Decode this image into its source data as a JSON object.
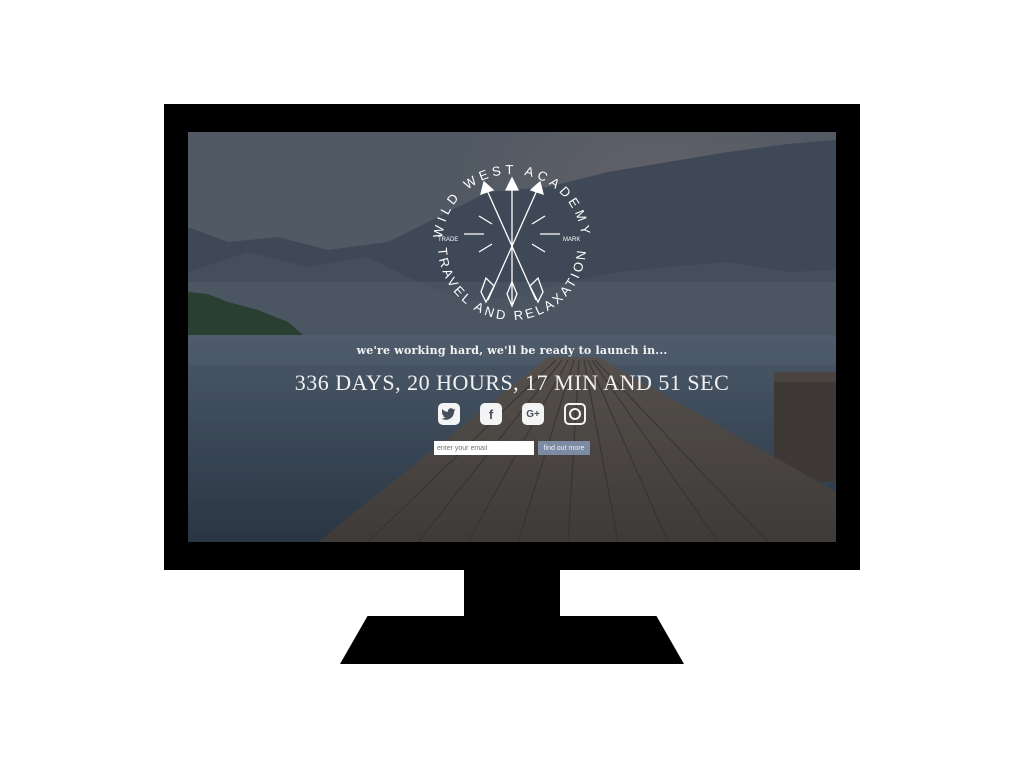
{
  "logo": {
    "top_text": "WILD WEST ACADEMY",
    "bottom_text": "TRAVEL AND RELAXATION",
    "left_mark": "TRADE",
    "right_mark": "MARK"
  },
  "tagline": "we're working hard, we'll be ready to launch in...",
  "countdown": "336 DAYS, 20 HOURS, 17 MIN AND 51 SEC",
  "socials": {
    "twitter": "twitter-icon",
    "facebook": "facebook-icon",
    "facebook_glyph": "f",
    "googleplus": "google-plus-icon",
    "googleplus_glyph": "G+",
    "instagram": "instagram-icon"
  },
  "form": {
    "email_placeholder": "enter your email",
    "button_label": "find out more",
    "button_color": "#7c8aa4"
  }
}
